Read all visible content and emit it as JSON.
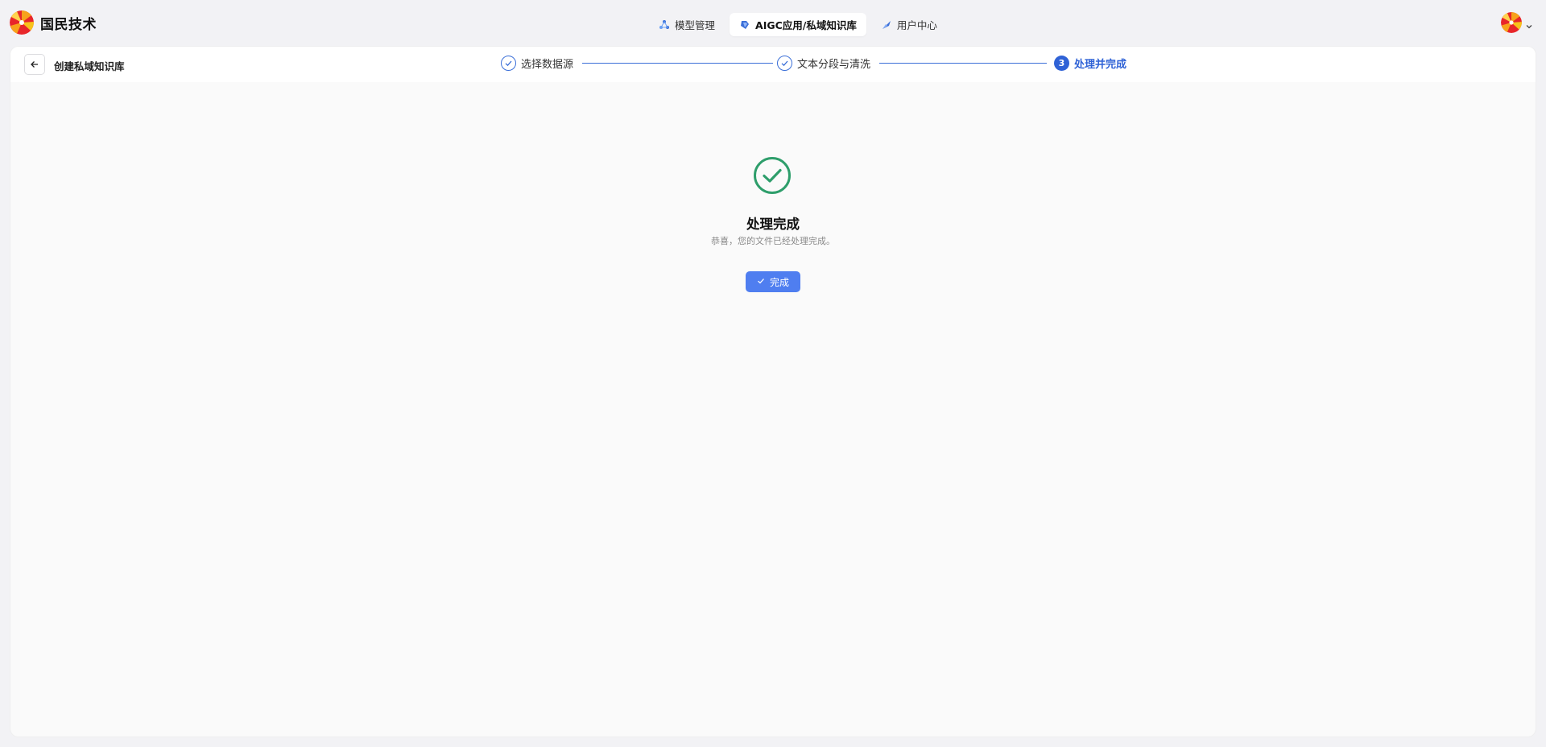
{
  "app": {
    "logo_text": "国民技术"
  },
  "nav": {
    "items": [
      {
        "label": "模型管理",
        "icon": "model-icon",
        "active": false
      },
      {
        "label": "AIGC应用/私域知识库",
        "icon": "knowledge-icon",
        "active": true
      },
      {
        "label": "用户中心",
        "icon": "user-center-icon",
        "active": false
      }
    ]
  },
  "header": {
    "title": "创建私域知识库"
  },
  "steps": [
    {
      "label": "选择数据源",
      "status": "done"
    },
    {
      "label": "文本分段与清洗",
      "status": "done"
    },
    {
      "label": "处理并完成",
      "status": "current",
      "number": "3"
    }
  ],
  "result": {
    "title": "处理完成",
    "subtitle": "恭喜，您的文件已经处理完成。",
    "button_label": "完成"
  },
  "colors": {
    "primary": "#2f62d6",
    "button": "#4f7ef0",
    "success": "#2e9e6b"
  }
}
